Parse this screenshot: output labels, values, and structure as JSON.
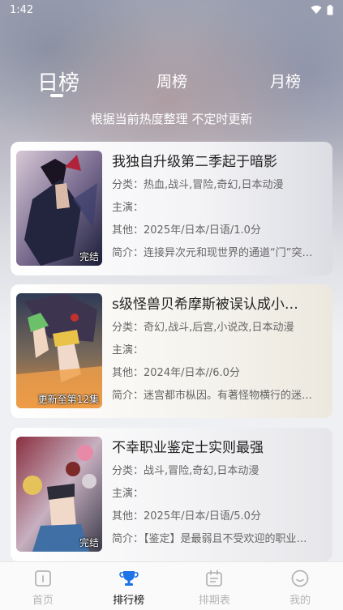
{
  "status": {
    "time": "1:42"
  },
  "tabs": [
    {
      "label": "日榜",
      "active": true
    },
    {
      "label": "周榜",
      "active": false
    },
    {
      "label": "月榜",
      "active": false
    }
  ],
  "subtitle": "根据当前热度整理 不定时更新",
  "labels": {
    "category": "分类：",
    "cast": "主演：",
    "other": "其他：",
    "intro": "简介："
  },
  "items": [
    {
      "title": "我独自升级第二季起于暗影",
      "category": "热血,战斗,冒险,奇幻,日本动漫",
      "cast": "",
      "other": "2025年/日本/日语/1.0分",
      "intro": "连接异次元和现世界的通道“门”突…",
      "badge": "完结"
    },
    {
      "title": "s级怪兽贝希摩斯被误认成小…",
      "category": "奇幻,战斗,后宫,小说改,日本动漫",
      "cast": "",
      "other": "2024年/日本//6.0分",
      "intro": "迷宫都市枞因。有著怪物横行的迷…",
      "badge": "更新至第12集"
    },
    {
      "title": "不幸职业鉴定士实则最强",
      "category": "战斗,冒险,奇幻,日本动漫",
      "cast": "",
      "other": "2025年/日本/日语/5.0分",
      "intro": "【鉴定】是最弱且不受欢迎的职业…",
      "badge": "完结"
    }
  ],
  "nav": [
    {
      "label": "首页",
      "icon": "home-icon",
      "active": false
    },
    {
      "label": "排行榜",
      "icon": "trophy-icon",
      "active": true
    },
    {
      "label": "排期表",
      "icon": "calendar-icon",
      "active": false
    },
    {
      "label": "我的",
      "icon": "smiley-icon",
      "active": false
    }
  ],
  "colors": {
    "active_nav": "#111111",
    "accent_trophy": "#1e73e8",
    "inactive_nav": "#b5b5b5"
  }
}
